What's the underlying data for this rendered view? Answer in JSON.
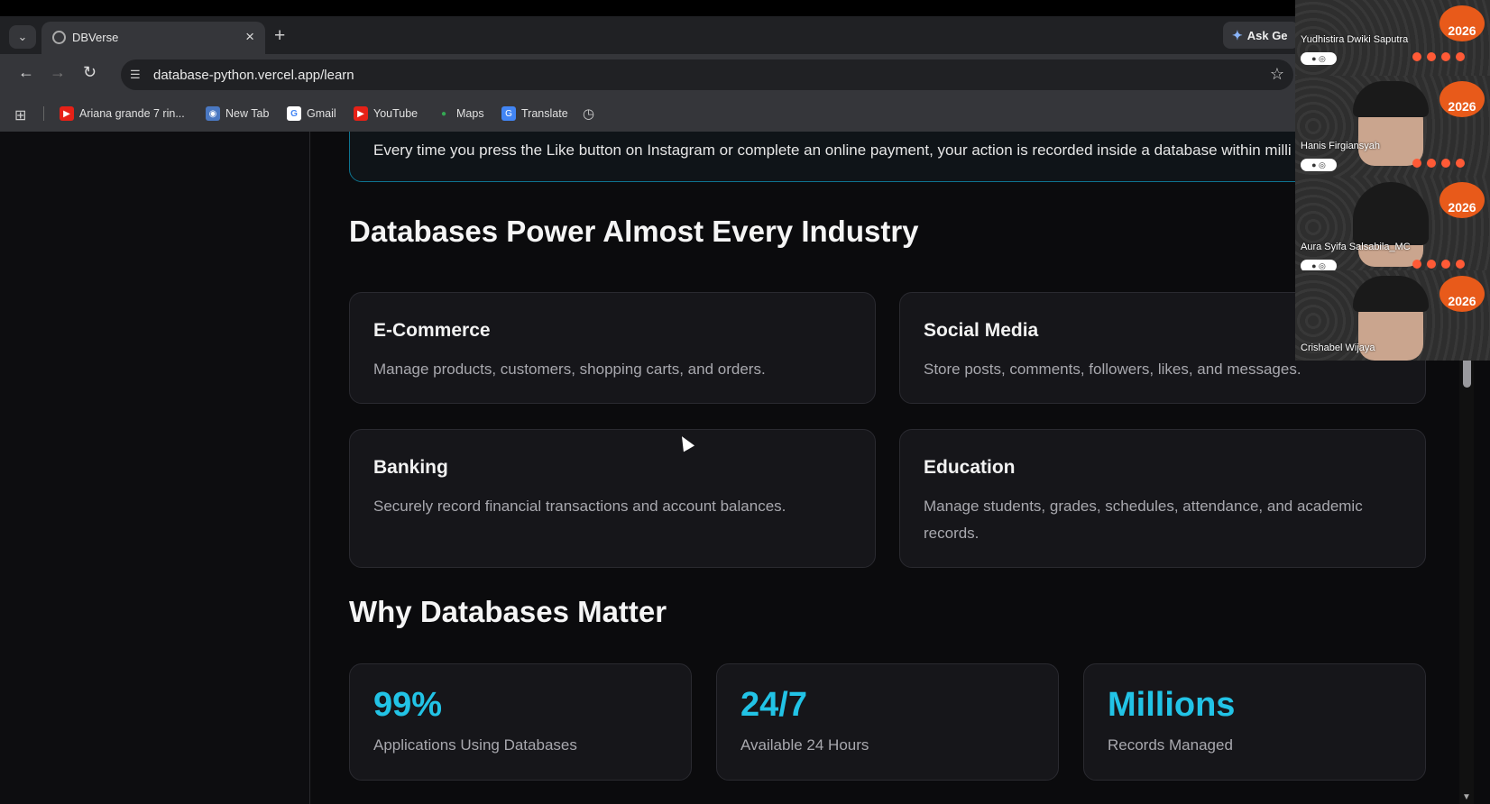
{
  "browser": {
    "tab_title": "DBVerse",
    "url": "database-python.vercel.app/learn",
    "ask_gemini_label": "Ask Ge",
    "bookmarks": [
      {
        "label": "Ariana grande 7 rin...",
        "icon": "youtube-icon"
      },
      {
        "label": "New Tab",
        "icon": "new-tab-icon"
      },
      {
        "label": "Gmail",
        "icon": "google-icon"
      },
      {
        "label": "YouTube",
        "icon": "youtube-icon"
      },
      {
        "label": "Maps",
        "icon": "maps-icon"
      },
      {
        "label": "Translate",
        "icon": "translate-icon"
      }
    ]
  },
  "page": {
    "info_text": "Every time you press the Like button on Instagram or complete an online payment, your action is recorded inside a database within milli",
    "industries_heading": "Databases Power Almost Every Industry",
    "industries": [
      {
        "title": "E-Commerce",
        "desc": "Manage products, customers, shopping carts, and orders."
      },
      {
        "title": "Social Media",
        "desc": "Store posts, comments, followers, likes, and messages."
      },
      {
        "title": "Banking",
        "desc": "Securely record financial transactions and account balances."
      },
      {
        "title": "Education",
        "desc": "Manage students, grades, schedules, attendance, and academic records."
      }
    ],
    "why_heading": "Why Databases Matter",
    "stats": [
      {
        "value": "99%",
        "label": "Applications Using Databases"
      },
      {
        "value": "24/7",
        "label": "Available 24 Hours"
      },
      {
        "value": "Millions",
        "label": "Records Managed"
      }
    ]
  },
  "meeting": {
    "participants": [
      {
        "name": "Yudhistira Dwiki Saputra"
      },
      {
        "name": "Hanis Firgiansyah"
      },
      {
        "name": "Aura Syifa Salsabila_MC"
      },
      {
        "name": "Crishabel Wijaya"
      }
    ],
    "badge_text": "2026",
    "accent_color": "#22c3e6"
  }
}
